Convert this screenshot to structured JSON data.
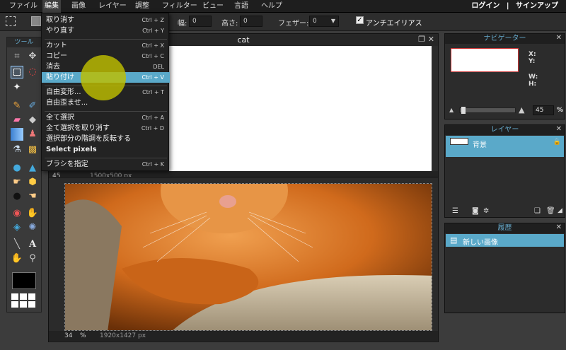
{
  "menubar": {
    "items": [
      "ファイル",
      "編集",
      "画像",
      "レイヤー",
      "調整",
      "フィルター",
      "ビュー",
      "言語",
      "ヘルプ"
    ],
    "active_index": 1,
    "login": "ログイン",
    "separator": "|",
    "signup": "サインアップ"
  },
  "toolbar": {
    "width_label": "幅:",
    "width_value": "0",
    "height_label": "高さ:",
    "height_value": "0",
    "feather_label": "フェザー:",
    "feather_value": "0",
    "antialias_label": "アンチエイリアス",
    "antialias_checked": true
  },
  "tools_panel": {
    "title": "ツール"
  },
  "edit_menu": {
    "items": [
      {
        "label": "取り消す",
        "shortcut": "Ctrl + Z"
      },
      {
        "label": "やり直す",
        "shortcut": "Ctrl + Y"
      },
      {
        "label": "カット",
        "shortcut": "Ctrl + X"
      },
      {
        "label": "コピー",
        "shortcut": "Ctrl + C"
      },
      {
        "label": "消去",
        "shortcut": "DEL"
      },
      {
        "label": "貼り付け",
        "shortcut": "Ctrl + V"
      },
      {
        "label": "自由変形...",
        "shortcut": "Ctrl + T"
      },
      {
        "label": "自由歪ませ...",
        "shortcut": ""
      },
      {
        "label": "全て選択",
        "shortcut": "Ctrl + A"
      },
      {
        "label": "全て選択を取り消す",
        "shortcut": "Ctrl + D"
      },
      {
        "label": "選択部分の階調を反転する",
        "shortcut": ""
      },
      {
        "label": "Select pixels",
        "shortcut": ""
      },
      {
        "label": "ブラシを指定",
        "shortcut": "Ctrl + K"
      }
    ],
    "highlighted_index": 5
  },
  "document1": {
    "title": "cat",
    "zoom": "45",
    "size": "1500x500 px"
  },
  "document2": {
    "zoom": "34",
    "percent": "%",
    "size": "1920x1427 px"
  },
  "navigator": {
    "title": "ナビゲーター",
    "x_label": "X:",
    "y_label": "Y:",
    "w_label": "W:",
    "h_label": "H:",
    "zoom_value": "45",
    "zoom_unit": "%"
  },
  "layers": {
    "title": "レイヤー",
    "items": [
      {
        "name": "背景"
      }
    ]
  },
  "history": {
    "title": "履歴",
    "items": [
      {
        "name": "新しい画像"
      }
    ]
  },
  "colors": {
    "accent": "#5aa9c9",
    "panel_title": "#66aacc"
  }
}
